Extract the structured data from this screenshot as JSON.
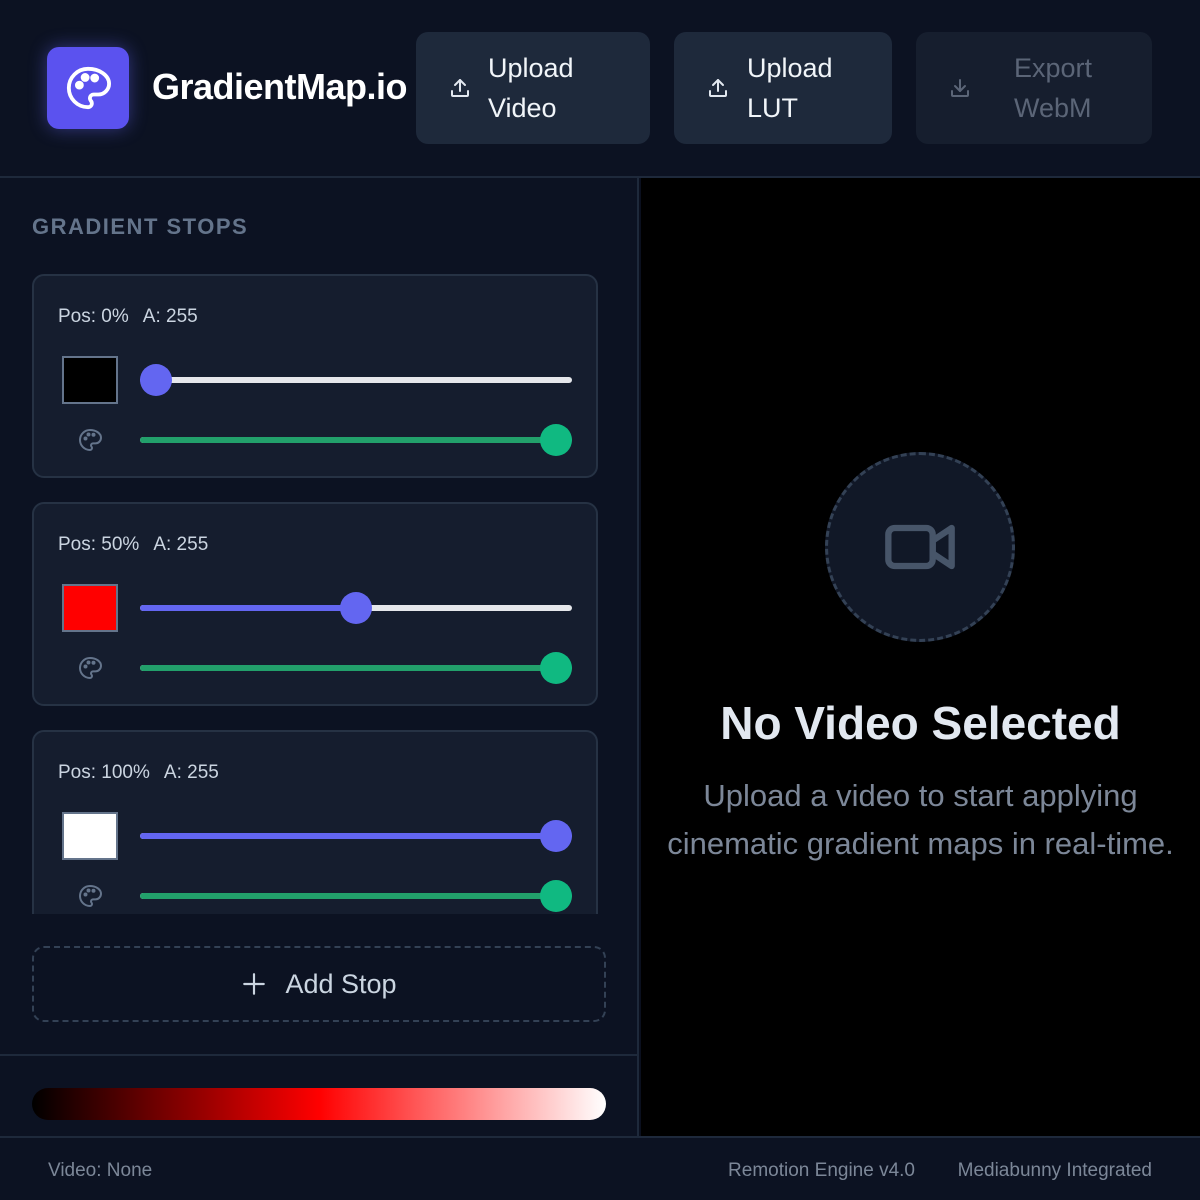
{
  "app": {
    "title": "GradientMap.io",
    "logo_icon": "palette-icon",
    "brand_color": "#5b52ef"
  },
  "toolbar": {
    "upload_video": {
      "label": "Upload\nVideo",
      "icon": "upload-icon",
      "enabled": true
    },
    "upload_lut": {
      "label": "Upload\nLUT",
      "icon": "upload-icon",
      "enabled": true
    },
    "export_webm": {
      "label": "Export\nWebM",
      "icon": "download-icon",
      "enabled": false
    }
  },
  "sidebar": {
    "section_title": "GRADIENT STOPS",
    "stops": [
      {
        "pos_text": "Pos: 0%",
        "alpha_text": "A: 255",
        "color": "#000000",
        "position": 0,
        "alpha": 255
      },
      {
        "pos_text": "Pos: 50%",
        "alpha_text": "A: 255",
        "color": "#ff0000",
        "position": 50,
        "alpha": 255
      },
      {
        "pos_text": "Pos: 100%",
        "alpha_text": "A: 255",
        "color": "#ffffff",
        "position": 100,
        "alpha": 255
      }
    ],
    "add_stop_label": "Add Stop"
  },
  "viewer": {
    "empty_title": "No Video Selected",
    "empty_description": "Upload a video to start applying cinematic gradient maps in real-time.",
    "empty_icon": "video-camera-icon"
  },
  "footer": {
    "video_status": "Video: None",
    "engine": "Remotion Engine v4.0",
    "integration": "Mediabunny Integrated"
  },
  "colors": {
    "accent": "#6366f1",
    "alpha_accent": "#10b981"
  }
}
